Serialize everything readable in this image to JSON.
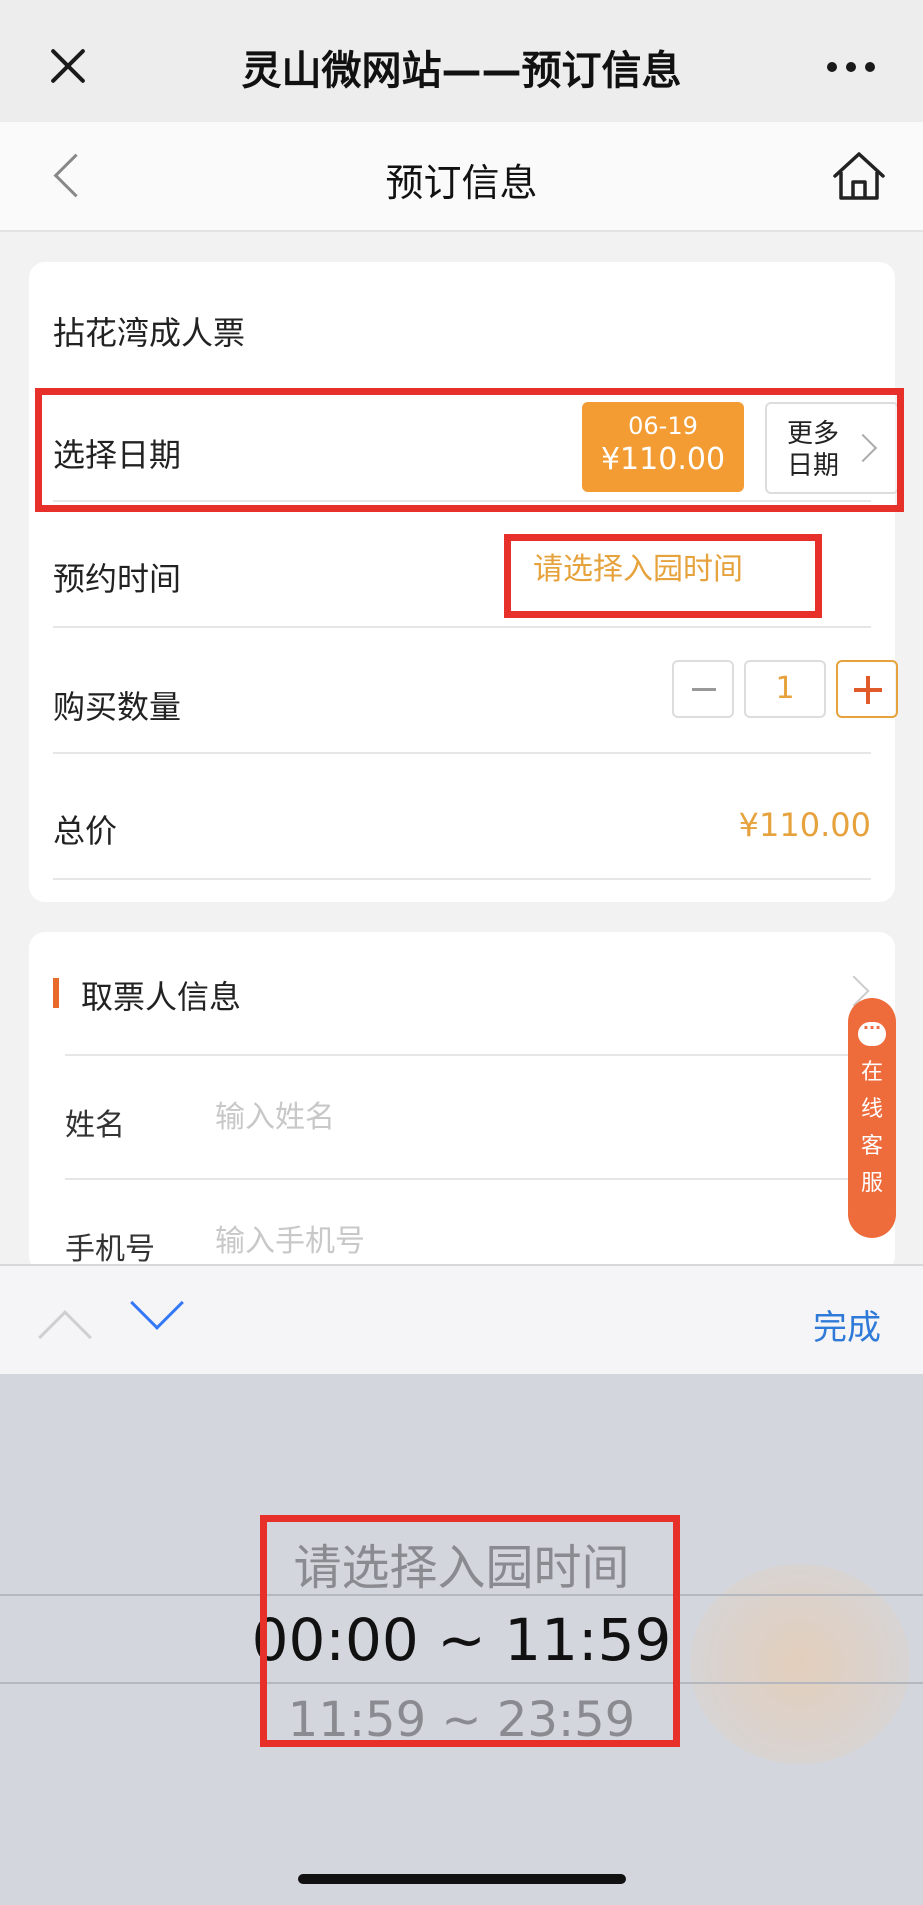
{
  "wechat_bar": {
    "title": "灵山微网站——预订信息"
  },
  "nav": {
    "title": "预订信息"
  },
  "booking": {
    "ticket_name": "拈花湾成人票",
    "date_label": "选择日期",
    "date_chip": {
      "date": "06-19",
      "price": "¥110.00"
    },
    "more_dates_label": "更多\n日期",
    "time_label": "预约时间",
    "time_placeholder": "请选择入园时间",
    "quantity_label": "购买数量",
    "quantity_value": "1",
    "total_label": "总价",
    "total_value": "¥110.00"
  },
  "ticket_holder": {
    "title": "取票人信息",
    "name_label": "姓名",
    "name_placeholder": "输入姓名",
    "phone_label": "手机号",
    "phone_placeholder": "输入手机号"
  },
  "service": {
    "label": "在线客服"
  },
  "keyboard_bar": {
    "done_label": "完成"
  },
  "picker": {
    "options": [
      "请选择入园时间",
      "00:00 ~ 11:59",
      "11:59 ~ 23:59"
    ],
    "selected": "00:00 ~ 11:59"
  },
  "colors": {
    "accent_orange": "#f39c33",
    "price_text": "#e6a23c",
    "annotation_red": "#e8302a",
    "done_blue": "#2f7ad8"
  }
}
